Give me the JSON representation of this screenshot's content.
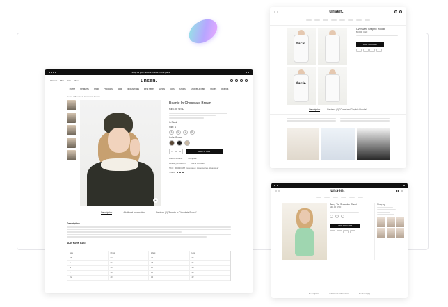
{
  "main": {
    "topbar_text": "Shop all your favorite brands in one place",
    "logo": "unsen.",
    "header_links": [
      "Women",
      "Men",
      "Kids",
      "About"
    ],
    "nav": [
      "Home",
      "Features",
      "Shop",
      "Products",
      "Blog",
      "New Arrivals",
      "Best seller",
      "Deals",
      "Tops",
      "Shoes",
      "Shower & Bath",
      "Stores",
      "Brands"
    ],
    "breadcrumb": "Home > Beanie In Chocolate Brown",
    "product_title": "Beanie In Chocolate Brown",
    "price": "$46.00 USD",
    "in_stock": "In Stock",
    "size_label": "Size: S",
    "sizes": [
      "S",
      "M",
      "L",
      "XL"
    ],
    "color_label": "Color: Brown",
    "qty": "1",
    "add_to_cart": "ADD TO CART",
    "wishlist": "Add to wishlist",
    "compare": "Compare",
    "delivery": "Delivery & Return",
    "ask": "Ask a Question",
    "sku": "SKU: 00413CRM",
    "categories": "Categories: Accessories, Headwear",
    "share": "Share:",
    "tabs": [
      "Description",
      "Additional Information",
      "Reviews (0) \"Beanie In Chocolate Brown\""
    ],
    "desc_heading": "Description",
    "size_heading": "SIZE YOUR BAG",
    "size_table_headers": [
      "Size",
      "Chest",
      "Waist",
      "Hips"
    ],
    "size_rows": [
      [
        "XS",
        "32",
        "26",
        "34"
      ],
      [
        "S",
        "34",
        "28",
        "36"
      ],
      [
        "M",
        "36",
        "30",
        "38"
      ],
      [
        "L",
        "38",
        "32",
        "40"
      ],
      [
        "XL",
        "40",
        "34",
        "42"
      ]
    ]
  },
  "top_right": {
    "logo": "unsen.",
    "product_title": "Oversized Graphic Hoodie",
    "price": "$56.00 USD",
    "shirt_text": "fuck.",
    "add_to_cart": "ADD TO CART",
    "tabs": [
      "Description",
      "Reviews (0) \"Oversized Graphic Hoodie\""
    ]
  },
  "bottom_right": {
    "logo": "unsen.",
    "product_title": "Baby Tie Shoulder Cami",
    "price": "$38.00 USD",
    "add_to_cart": "ADD TO CART",
    "sidebar_title": "Shop by",
    "tabs": [
      "Description",
      "Additional Information",
      "Reviews (0)"
    ]
  },
  "colors": {
    "brand_dark": "#111111",
    "accent_gem_start": "#8ef0e0",
    "accent_gem_end": "#f3a8ff"
  }
}
